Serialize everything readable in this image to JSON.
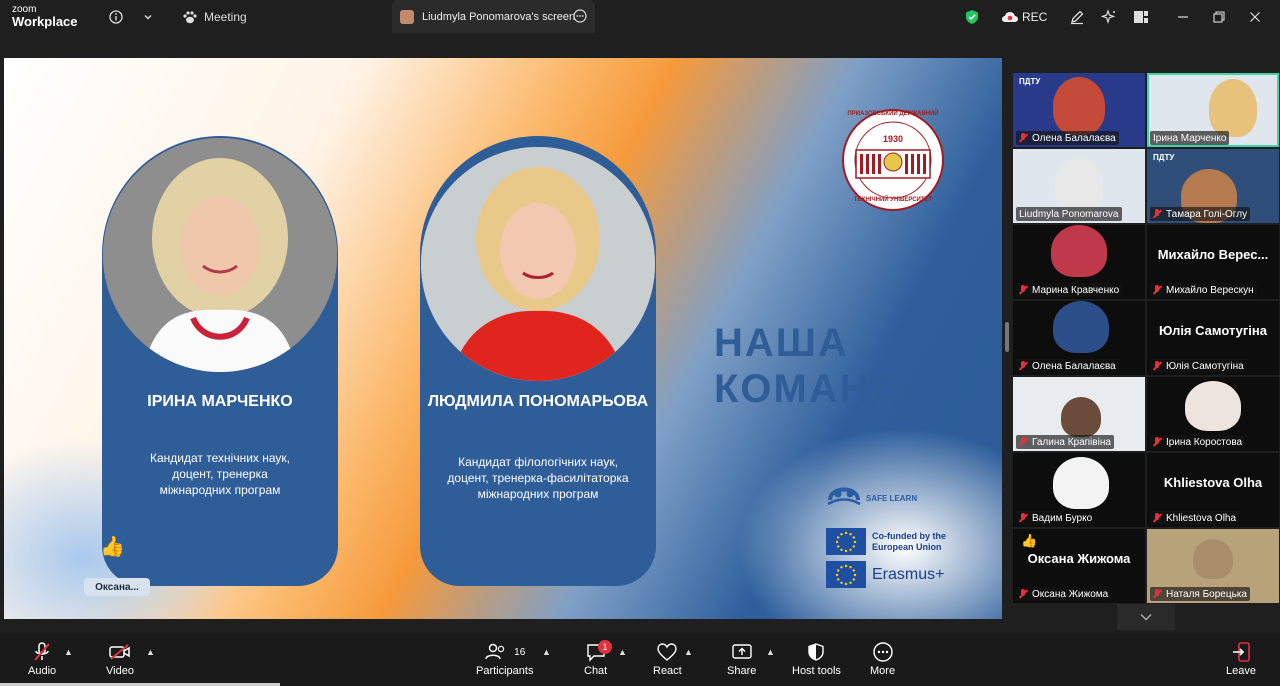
{
  "app": {
    "logo_line1": "zoom",
    "logo_line2": "Workplace",
    "meeting_label": "Meeting",
    "screen_tab": "Liudmyla Ponomarova's screen",
    "rec_label": "REC"
  },
  "slide": {
    "left_card": {
      "name": "ІРИНА МАРЧЕНКО",
      "desc": "Кандидат технічних наук, доцент, тренерка міжнародних програм"
    },
    "right_card": {
      "name": "ЛЮДМИЛА ПОНОМАРЬОВА",
      "desc": "Кандидат філологічних наук, доцент, тренерка-фасилітаторка міжнародних програм"
    },
    "headline": "НАША КОМАНДА",
    "seal_top": "ПРИАЗОВСЬКИЙ ДЕРЖАВНИЙ",
    "seal_year": "1930",
    "seal_bottom": "ТЕХНІЧНИЙ УНІВЕРСИТЕТ",
    "safe_learn": "SAFE LEARN",
    "eu_text": "Co-funded by the European Union",
    "erasmus": "Erasmus+",
    "name_tag": "Оксана..."
  },
  "gallery": [
    {
      "label": "Олена Балалаєва",
      "big": ""
    },
    {
      "label": "Ірина Марченко",
      "big": ""
    },
    {
      "label": "Liudmyla Ponomarova",
      "big": ""
    },
    {
      "label": "Тамара Голі-Оглу",
      "big": ""
    },
    {
      "label": "Марина Кравченко",
      "big": ""
    },
    {
      "label": "Михайло Верескун",
      "big": "Михайло  Верес..."
    },
    {
      "label": "Олена Балалаєва",
      "big": ""
    },
    {
      "label": "Юлія Самотугіна",
      "big": "Юлія Самотугіна"
    },
    {
      "label": "Галина Крапівіна",
      "big": ""
    },
    {
      "label": "Ірина Коростова",
      "big": ""
    },
    {
      "label": "Вадим Бурко",
      "big": ""
    },
    {
      "label": "Khliestova Olha",
      "big": "Khliestova Olha"
    },
    {
      "label": "Оксана Жижома",
      "big": "Оксана Жижома"
    },
    {
      "label": "Наталя Борецька",
      "big": ""
    }
  ],
  "ptdu_label": "ПДТУ",
  "toolbar": {
    "audio": "Audio",
    "video": "Video",
    "participants": "Participants",
    "participants_count": "16",
    "chat": "Chat",
    "chat_badge": "1",
    "react": "React",
    "share": "Share",
    "host_tools": "Host tools",
    "more": "More",
    "leave": "Leave"
  },
  "colors": {
    "slide_blue": "#2f5d97",
    "accent_orange": "#f59a3c",
    "mute_red": "#e2323d",
    "active_green": "#3fd3a6"
  }
}
